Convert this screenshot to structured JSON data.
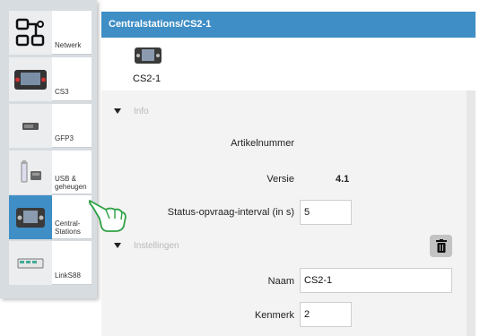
{
  "sidebar": {
    "items": [
      {
        "label": "Netwerk",
        "icon": "network-icon"
      },
      {
        "label": "CS3",
        "icon": "cs3-device-icon"
      },
      {
        "label": "GFP3",
        "icon": "gfp3-device-icon"
      },
      {
        "label": "USB &\ngeheugen",
        "icon": "usb-memory-icon"
      },
      {
        "label": "Central-\nStations",
        "icon": "central-station-icon",
        "active": true
      },
      {
        "label": "LinkS88",
        "icon": "links88-device-icon"
      }
    ]
  },
  "header": {
    "title": "Centralstations/CS2-1"
  },
  "device": {
    "name": "CS2-1",
    "icon": "cs2-device-icon"
  },
  "info": {
    "section_title": "Info",
    "artikelnummer_label": "Artikelnummer",
    "artikelnummer_value": "",
    "versie_label": "Versie",
    "versie_value": "4.1",
    "status_interval_label": "Status-opvraag-interval (in s)",
    "status_interval_value": "5"
  },
  "settings": {
    "section_title": "Instellingen",
    "delete_icon": "trash-icon",
    "naam_label": "Naam",
    "naam_value": "CS2-1",
    "kenmerk_label": "Kenmerk",
    "kenmerk_value": "2"
  },
  "colors": {
    "accent": "#3f8ec6",
    "sidebar_bg": "#d7dce1",
    "panel_bg": "#f3f3f3"
  }
}
